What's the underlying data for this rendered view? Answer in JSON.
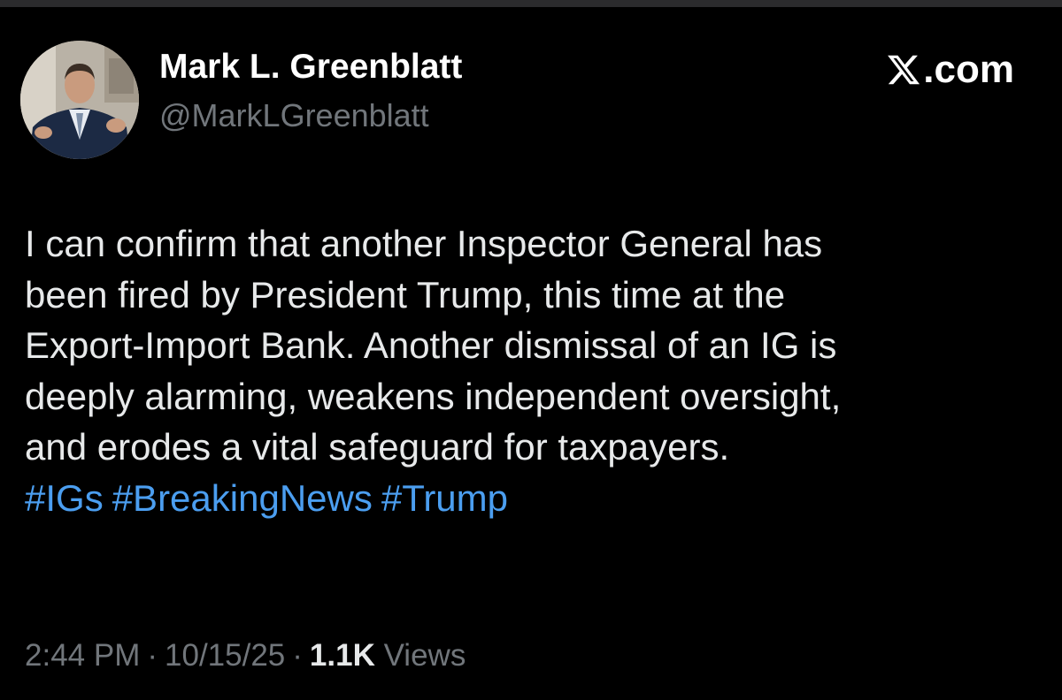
{
  "author": {
    "name": "Mark L. Greenblatt",
    "handle": "@MarkLGreenblatt",
    "avatar_icon": "profile-photo"
  },
  "brand": {
    "label": ".com",
    "logo_icon": "x-logo-icon"
  },
  "tweet": {
    "lines": [
      "I can confirm that another Inspector General has",
      "been fired by President Trump, this time at the",
      "Export-Import Bank. Another dismissal of an IG is",
      "deeply alarming, weakens independent oversight,",
      "and erodes a vital safeguard for taxpayers."
    ],
    "hashtags": [
      "#IGs",
      "#BreakingNews",
      "#Trump"
    ]
  },
  "meta": {
    "time": "2:44 PM",
    "date": "10/15/25",
    "views_count": "1.1K",
    "views_label": "Views",
    "separator": "·"
  },
  "colors": {
    "background": "#000000",
    "text": "#e7e9ea",
    "secondary": "#71767b",
    "hashtag": "#4b9ef0"
  }
}
